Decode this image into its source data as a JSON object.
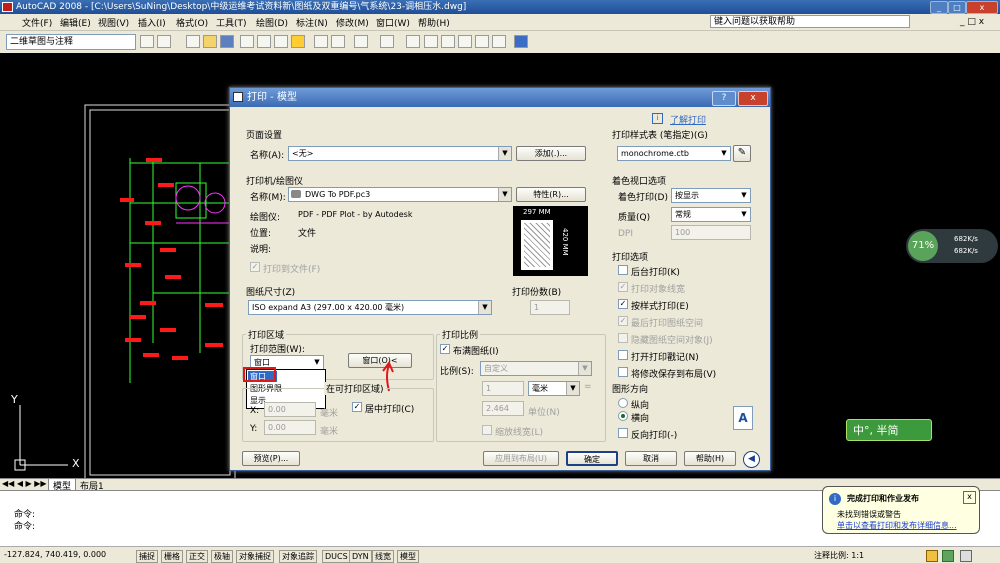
{
  "window": {
    "title": "AutoCAD 2008 - [C:\\Users\\SuNing\\Desktop\\中级运维考试资料新\\图纸及双重编号\\气系统\\23-调相压水.dwg]",
    "min": "_",
    "max": "□",
    "close": "x"
  },
  "menu": [
    "文件(F)",
    "编辑(E)",
    "视图(V)",
    "插入(I)",
    "格式(O)",
    "工具(T)",
    "绘图(D)",
    "标注(N)",
    "修改(M)",
    "窗口(W)",
    "帮助(H)"
  ],
  "help_search_placeholder": "键入问题以获取帮助",
  "workspace": "二维草图与注释",
  "dialog": {
    "title": "打印 - 模型",
    "help_link": "了解打印",
    "page_setup": {
      "section": "页面设置",
      "name_label": "名称(A):",
      "name_value": "<无>",
      "add_button": "添加(.)..."
    },
    "printer": {
      "section": "打印机/绘图仪",
      "name_label": "名称(M):",
      "name_value": "DWG To PDF.pc3",
      "properties_button": "特性(R)...",
      "plotter_label": "绘图仪:",
      "plotter_value": "PDF - PDF Plot - by Autodesk",
      "location_label": "位置:",
      "location_value": "文件",
      "description_label": "说明:",
      "plot_to_file": "打印到文件(F)",
      "preview_width": "297 MM",
      "preview_height": "420 MM"
    },
    "paper_size": {
      "section": "图纸尺寸(Z)",
      "value": "ISO expand A3 (297.00 x 420.00 毫米)"
    },
    "copies": {
      "section": "打印份数(B)",
      "value": "1"
    },
    "plot_area": {
      "section": "打印区域",
      "what_label": "打印范围(W):",
      "what_value": "窗口",
      "window_button": "窗口(O)<",
      "options": [
        "窗口",
        "图形界限",
        "显示"
      ]
    },
    "plot_offset": {
      "section_partial": "在可打印区域)",
      "center_plot": "居中打印(C)",
      "x_label": "X:",
      "y_label": "Y:",
      "x_value": "0.00",
      "y_value": "0.00",
      "unit": "毫米"
    },
    "plot_scale": {
      "section": "打印比例",
      "fit_paper": "布满图纸(I)",
      "scale_label": "比例(S):",
      "scale_value": "自定义",
      "value1": "1",
      "unit1": "毫米",
      "value2": "2.464",
      "unit2": "单位(N)",
      "scale_lineweights": "缩放线宽(L)"
    },
    "style_table": {
      "section": "打印样式表 (笔指定)(G)",
      "value": "monochrome.ctb"
    },
    "shaded_viewport": {
      "section": "着色视口选项",
      "shade_label": "着色打印(D)",
      "shade_value": "按显示",
      "quality_label": "质量(Q)",
      "quality_value": "常规",
      "dpi_label": "DPI",
      "dpi_value": "100"
    },
    "plot_options": {
      "section": "打印选项",
      "items": [
        {
          "label": "后台打印(K)",
          "checked": false,
          "enabled": true
        },
        {
          "label": "打印对象线宽",
          "checked": true,
          "enabled": false
        },
        {
          "label": "按样式打印(E)",
          "checked": true,
          "enabled": true
        },
        {
          "label": "最后打印图纸空间",
          "checked": true,
          "enabled": false
        },
        {
          "label": "隐藏图纸空间对象(J)",
          "checked": false,
          "enabled": false
        },
        {
          "label": "打开打印戳记(N)",
          "checked": false,
          "enabled": true
        },
        {
          "label": "将修改保存到布局(V)",
          "checked": false,
          "enabled": true
        }
      ]
    },
    "orientation": {
      "section": "图形方向",
      "portrait": "纵向",
      "landscape": "横向",
      "upside_down": "反向打印(-)",
      "selected": "landscape"
    },
    "buttons": {
      "preview": "预览(P)...",
      "apply_layout": "应用到布局(U)",
      "ok": "确定",
      "cancel": "取消",
      "help": "帮助(H)"
    }
  },
  "layout_tabs": [
    "模型",
    "布局1"
  ],
  "command_lines": [
    "命令:",
    "命令:"
  ],
  "coords": "-127.824, 740.419, 0.000",
  "status_toggles": [
    "捕捉",
    "栅格",
    "正交",
    "极轴",
    "对象捕捉",
    "对象追踪",
    "DUCS",
    "DYN",
    "线宽",
    "模型"
  ],
  "annotation_scale": "注释比例: 1:1",
  "balloon": {
    "title": "完成打印和作业发布",
    "line1": "未找到错误或警告",
    "link": "单击以查看打印和发布详细信息..."
  },
  "net_widget": {
    "percent": "71%",
    "up": "682K/s",
    "down": "682K/s"
  },
  "ime": "中°, 半简",
  "ucs": {
    "x": "X",
    "y": "Y"
  },
  "colors": {
    "accent": "#316ac5",
    "highlight_box": "#e01818",
    "drawing_red": "#ff1a1a",
    "drawing_green": "#33ff33",
    "drawing_magenta": "#ff33ff"
  }
}
